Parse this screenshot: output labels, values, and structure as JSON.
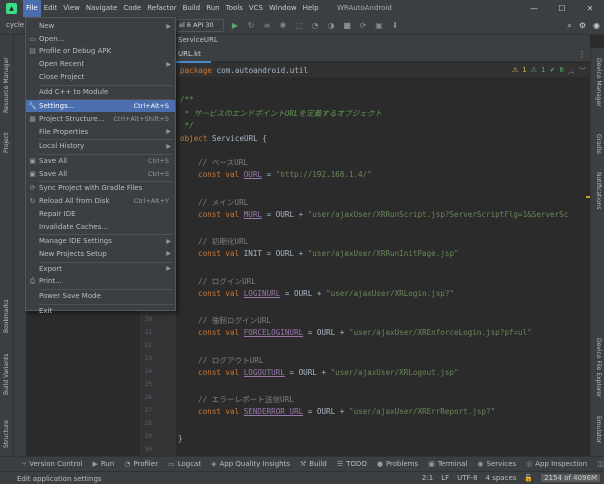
{
  "window": {
    "title": "WRAutoAndroid",
    "minimize": "—",
    "maximize": "☐",
    "close": "✕"
  },
  "menubar": [
    "File",
    "Edit",
    "View",
    "Navigate",
    "Code",
    "Refactor",
    "Build",
    "Run",
    "Tools",
    "VCS",
    "Window",
    "Help"
  ],
  "toolbar": {
    "breadcrumb": "cycle",
    "device": "el 6 API 30"
  },
  "tabs": {
    "top": "ServiceURL",
    "file": "URL.kt"
  },
  "inspections": {
    "warnings": "1",
    "weak": "1",
    "ok": "6"
  },
  "file_menu": [
    {
      "label": "New",
      "submenu": true
    },
    {
      "label": "Open...",
      "icon": "folder-icon"
    },
    {
      "label": "Profile or Debug APK",
      "icon": "apk-icon"
    },
    {
      "label": "Open Recent",
      "submenu": true
    },
    {
      "label": "Close Project"
    },
    {
      "sep": true
    },
    {
      "label": "Add C++ to Module"
    },
    {
      "sep": true
    },
    {
      "label": "Settings...",
      "shortcut": "Ctrl+Alt+S",
      "icon": "wrench-icon",
      "selected": true
    },
    {
      "label": "Project Structure...",
      "shortcut": "Ctrl+Alt+Shift+S",
      "icon": "structure-icon"
    },
    {
      "label": "File Properties",
      "submenu": true
    },
    {
      "sep": true
    },
    {
      "label": "Local History",
      "submenu": true
    },
    {
      "sep": true
    },
    {
      "label": "Save All",
      "shortcut": "Ctrl+S",
      "icon": "save-icon"
    },
    {
      "label": "Save All",
      "shortcut": "Ctrl+S",
      "icon": "save-icon"
    },
    {
      "sep": true
    },
    {
      "label": "Sync Project with Gradle Files",
      "icon": "sync-icon"
    },
    {
      "label": "Reload All from Disk",
      "shortcut": "Ctrl+Alt+Y",
      "icon": "reload-icon"
    },
    {
      "label": "Repair IDE"
    },
    {
      "label": "Invalidate Caches..."
    },
    {
      "sep": true
    },
    {
      "label": "Manage IDE Settings",
      "submenu": true
    },
    {
      "label": "New Projects Setup",
      "submenu": true
    },
    {
      "sep": true
    },
    {
      "label": "Export",
      "submenu": true
    },
    {
      "label": "Print...",
      "icon": "print-icon"
    },
    {
      "sep": true
    },
    {
      "label": "Power Save Mode"
    },
    {
      "sep": true
    },
    {
      "label": "Exit"
    }
  ],
  "code": {
    "package_kw": "package",
    "package_name": "com.autoandroid.util",
    "doc_open": "/**",
    "doc_text": " * サービスのエンドポイントURLを定義するオブジェクト",
    "doc_close": " */",
    "object_kw": "object",
    "object_name": "ServiceURL {",
    "blocks": [
      {
        "comment": "// ベースURL",
        "name": "OURL",
        "rhs_prefix": " = ",
        "value": "\"http://192.168.1.4/\"",
        "is_url": true
      },
      {
        "comment": "// メインURL",
        "name": "MURL",
        "rhs_prefix": " = OURL + ",
        "value": "\"user/ajaxUser/XRRunScript.jsp?ServerScriptFlg=1&ServerSc"
      },
      {
        "comment": "// 初期化URL",
        "name": "INIT",
        "rhs_prefix": " = OURL + ",
        "value": "\"user/ajaxUser/XRRunInitPage.jsp\"",
        "plain_name": true
      },
      {
        "comment": "// ログインURL",
        "name": "LOGINURL",
        "rhs_prefix": " = OURL + ",
        "value": "\"user/ajaxUser/XRLogin.jsp?\""
      },
      {
        "comment": "// 強制ログインURL",
        "name": "FORCELOGINURL",
        "rhs_prefix": " = OURL + ",
        "value": "\"user/ajaxUser/XREnforceLogin.jsp?pf=ul\""
      },
      {
        "comment": "// ログアウトURL",
        "name": "LOGOUTURL",
        "rhs_prefix": " = OURL + ",
        "value": "\"user/ajaxUser/XRLogout.jsp\""
      },
      {
        "comment": "// エラーレポート送信URL",
        "name": "SENDERROR_URL",
        "rhs_prefix": " = OURL + ",
        "value": "\"user/ajaxUser/XRErrReport.jsp?\""
      }
    ],
    "decl": "const val ",
    "closing": "}",
    "line_numbers": [
      "20",
      "21",
      "22",
      "23",
      "24",
      "25",
      "26",
      "27",
      "28",
      "29",
      "30"
    ]
  },
  "side_tools": {
    "left": [
      "Resource Manager",
      "Project",
      "Bookmarks",
      "Build Variants",
      "Structure"
    ],
    "right": [
      "Device Manager",
      "Gradle",
      "Notifications",
      "Device File Explorer",
      "Emulator"
    ]
  },
  "bottom_tools": [
    {
      "label": "Version Control",
      "icon": "branch-icon"
    },
    {
      "label": "Run",
      "icon": "run-icon"
    },
    {
      "label": "Profiler",
      "icon": "profiler-icon"
    },
    {
      "label": "Logcat",
      "icon": "logcat-icon"
    },
    {
      "label": "App Quality Insights",
      "icon": "insights-icon"
    },
    {
      "label": "Build",
      "icon": "hammer-icon"
    },
    {
      "label": "TODO",
      "icon": "list-icon"
    },
    {
      "label": "Problems",
      "icon": "info-icon"
    },
    {
      "label": "Terminal",
      "icon": "terminal-icon"
    },
    {
      "label": "Services",
      "icon": "services-icon"
    },
    {
      "label": "App Inspection",
      "icon": "inspection-icon"
    },
    {
      "label": "Layou",
      "icon": "layout-icon"
    }
  ],
  "status": {
    "message": "Edit application settings",
    "position": "2:1",
    "line_sep": "LF",
    "encoding": "UTF-8",
    "indent": "4 spaces",
    "memory": "2154 of 4096M"
  }
}
